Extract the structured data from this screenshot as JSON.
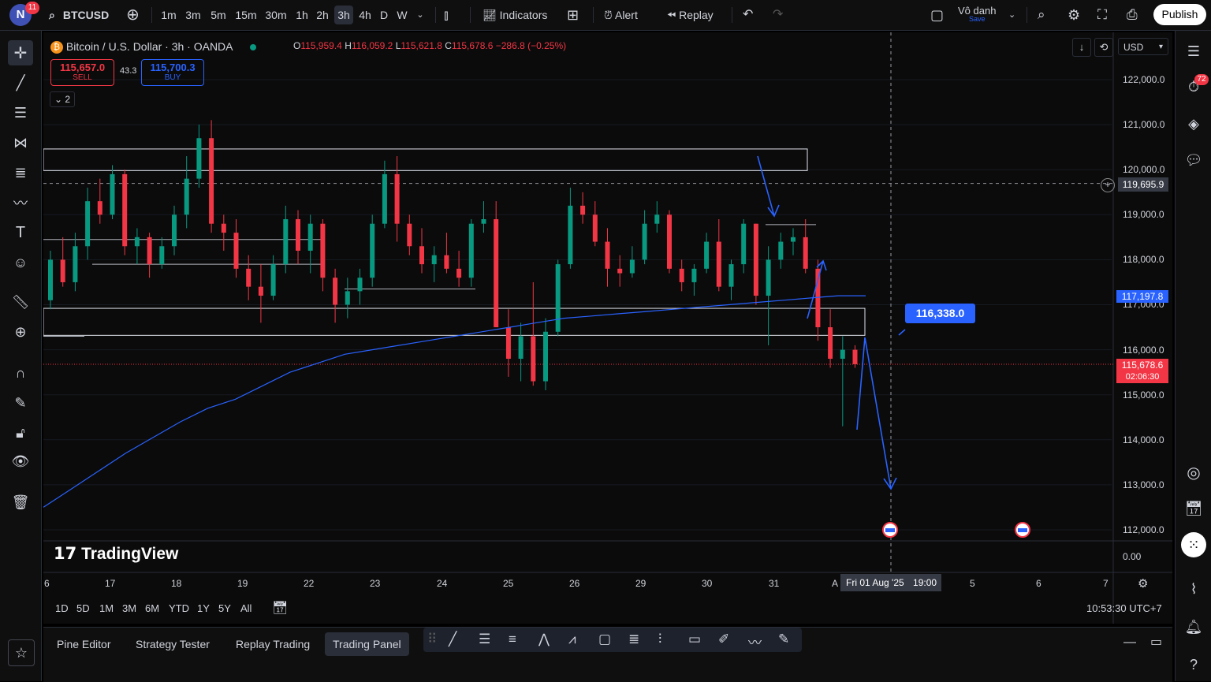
{
  "topbar": {
    "avatar_letter": "N",
    "notif_count": "11",
    "symbol": "BTCUSD",
    "timeframes": [
      "1m",
      "3m",
      "5m",
      "15m",
      "30m",
      "1h",
      "2h",
      "3h",
      "4h",
      "D",
      "W"
    ],
    "active_timeframe": "3h",
    "indicators_label": "Indicators",
    "alert_label": "Alert",
    "replay_label": "Replay",
    "layout_name": "Vô danh",
    "layout_status": "Save",
    "publish_label": "Publish"
  },
  "legend": {
    "title": "Bitcoin / U.S. Dollar · 3h · OANDA",
    "o_label": "O",
    "o": "115,959.4",
    "h_label": "H",
    "h": "116,059.2",
    "l_label": "L",
    "l": "115,621.8",
    "c_label": "C",
    "c": "115,678.6",
    "change": "−286.8 (−0.25%)",
    "sell_price": "115,657.0",
    "sell_label": "SELL",
    "spread": "43.3",
    "buy_price": "115,700.3",
    "buy_label": "BUY",
    "indicators_count": "2"
  },
  "chart_controls": {
    "currency": "USD"
  },
  "price_axis": {
    "labels": [
      "122,000.0",
      "121,000.0",
      "120,000.0",
      "119,000.0",
      "118,000.0",
      "117,000.0",
      "116,000.0",
      "115,000.0",
      "114,000.0",
      "113,000.0",
      "112,000.0",
      "0.00"
    ],
    "crosshair_price": "119,695.9",
    "ma_price": "117,197.8",
    "last_price": "115,678.6",
    "countdown": "02:06:30"
  },
  "time_axis": {
    "labels": [
      "6",
      "17",
      "18",
      "19",
      "22",
      "23",
      "24",
      "25",
      "26",
      "29",
      "30",
      "31",
      "A",
      "5",
      "6",
      "7"
    ],
    "crosshair_time": "Fri 01 Aug '25",
    "crosshair_hour": "19:00"
  },
  "annotation": {
    "price_label": "116,338.0"
  },
  "watermark": "TradingView",
  "ranges": [
    "1D",
    "5D",
    "1M",
    "3M",
    "6M",
    "YTD",
    "1Y",
    "5Y",
    "All"
  ],
  "clock": "10:53:30 UTC+7",
  "bottom_tabs": [
    "Pine Editor",
    "Strategy Tester",
    "Replay Trading",
    "Trading Panel"
  ],
  "active_tab": "Trading Panel",
  "right_badge": "72",
  "colors": {
    "up": "#089981",
    "down": "#f23645",
    "ma": "#2962ff",
    "accent": "#2962ff"
  },
  "chart_data": {
    "type": "candlestick",
    "title": "Bitcoin / U.S. Dollar · 3h · OANDA",
    "ylim": [
      111800,
      122500
    ],
    "x": [
      "16",
      "17",
      "18",
      "19",
      "22",
      "23",
      "24",
      "25",
      "26",
      "29",
      "30",
      "31",
      "Aug 1"
    ],
    "series": [
      {
        "type": "candlestick",
        "ohlc": [
          [
            117100,
            118200,
            116900,
            118000
          ],
          [
            118000,
            118500,
            117400,
            117500
          ],
          [
            117500,
            118600,
            117300,
            118300
          ],
          [
            118300,
            119600,
            118000,
            119300
          ],
          [
            119300,
            119800,
            118800,
            119000
          ],
          [
            119000,
            120100,
            118900,
            119900
          ],
          [
            119900,
            120000,
            118100,
            118300
          ],
          [
            118300,
            118700,
            117900,
            118500
          ],
          [
            118500,
            118600,
            117600,
            117900
          ],
          [
            117900,
            118500,
            117800,
            118300
          ],
          [
            118300,
            119200,
            118100,
            119000
          ],
          [
            119000,
            120300,
            118700,
            119800
          ],
          [
            119800,
            121000,
            119600,
            120700
          ],
          [
            120700,
            121100,
            118600,
            118800
          ],
          [
            118800,
            119000,
            118200,
            118600
          ],
          [
            118600,
            118900,
            117600,
            117800
          ],
          [
            117800,
            118100,
            117100,
            117400
          ],
          [
            117400,
            117900,
            116600,
            117200
          ],
          [
            117200,
            118100,
            117100,
            117900
          ],
          [
            117900,
            119200,
            117700,
            118900
          ],
          [
            118900,
            119100,
            117900,
            118200
          ],
          [
            118200,
            119000,
            117700,
            118800
          ],
          [
            118800,
            118900,
            117300,
            117600
          ],
          [
            117600,
            117800,
            116600,
            117000
          ],
          [
            117000,
            117600,
            116700,
            117300
          ],
          [
            117300,
            117800,
            117000,
            117600
          ],
          [
            117600,
            119000,
            117400,
            118800
          ],
          [
            118800,
            120200,
            118700,
            119900
          ],
          [
            119900,
            120300,
            118400,
            118800
          ],
          [
            118800,
            119000,
            118100,
            118300
          ],
          [
            118300,
            118700,
            117700,
            117900
          ],
          [
            117900,
            118300,
            117500,
            118100
          ],
          [
            118100,
            118600,
            117700,
            117800
          ],
          [
            117800,
            118200,
            117400,
            117600
          ],
          [
            117600,
            118900,
            117400,
            118800
          ],
          [
            118800,
            119300,
            118600,
            118900
          ],
          [
            118900,
            119300,
            116500,
            116500
          ],
          [
            116500,
            116900,
            115400,
            115800
          ],
          [
            115800,
            116600,
            115300,
            116300
          ],
          [
            116300,
            117500,
            115200,
            115300
          ],
          [
            115300,
            116700,
            115100,
            116400
          ],
          [
            116400,
            118000,
            116300,
            117900
          ],
          [
            117900,
            119600,
            117800,
            119200
          ],
          [
            119200,
            119500,
            118800,
            119000
          ],
          [
            119000,
            119300,
            118300,
            118400
          ],
          [
            118400,
            118700,
            117400,
            117800
          ],
          [
            117800,
            118100,
            117400,
            117700
          ],
          [
            117700,
            118300,
            117600,
            118000
          ],
          [
            118000,
            119100,
            117900,
            118800
          ],
          [
            118800,
            119300,
            118600,
            119000
          ],
          [
            119000,
            119100,
            117700,
            117800
          ],
          [
            117800,
            118000,
            117300,
            117500
          ],
          [
            117500,
            117900,
            117200,
            117800
          ],
          [
            117800,
            118600,
            117700,
            118400
          ],
          [
            118400,
            118900,
            117300,
            117400
          ],
          [
            117400,
            118000,
            117100,
            117900
          ],
          [
            117900,
            118900,
            117700,
            118800
          ],
          [
            118800,
            118800,
            117000,
            117200
          ],
          [
            117200,
            118300,
            116100,
            118000
          ],
          [
            118000,
            118600,
            117800,
            118400
          ],
          [
            118400,
            118700,
            118100,
            118500
          ],
          [
            118500,
            118900,
            117700,
            117800
          ],
          [
            117800,
            118000,
            116200,
            116500
          ],
          [
            116500,
            116900,
            115600,
            115800
          ],
          [
            115800,
            116300,
            114300,
            116000
          ],
          [
            116000,
            116100,
            115600,
            115679
          ]
        ]
      },
      {
        "type": "line",
        "values": [
          112500,
          112900,
          113300,
          113700,
          114050,
          114400,
          114700,
          114900,
          115200,
          115500,
          115700,
          115900,
          116000,
          116100,
          116200,
          116300,
          116400,
          116500,
          116600,
          116700,
          116750,
          116800,
          116850,
          116900,
          116950,
          117000,
          117050,
          117100,
          117150,
          117200,
          117200
        ]
      }
    ]
  }
}
